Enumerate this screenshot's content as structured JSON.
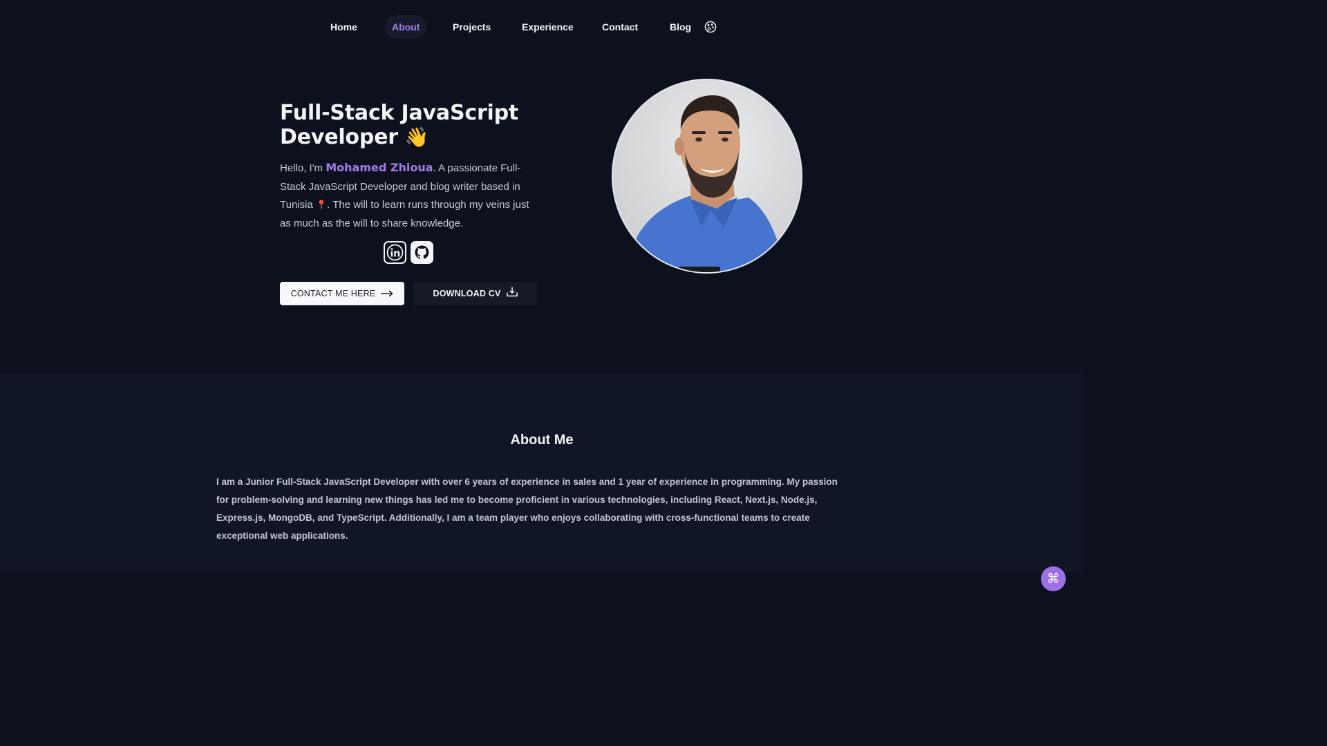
{
  "nav": {
    "items": [
      {
        "label": "Home"
      },
      {
        "label": "About",
        "active": true
      },
      {
        "label": "Projects"
      },
      {
        "label": "Experience"
      },
      {
        "label": "Contact"
      },
      {
        "label": "Blog"
      }
    ],
    "theme_icon": "palette-icon"
  },
  "hero": {
    "title": "Full-Stack JavaScript Developer",
    "wave_emoji": "👋",
    "intro_prefix": "Hello, I'm ",
    "name": "Mohamed Zhioua",
    "intro_mid": ". A passionate Full-Stack JavaScript Developer and blog writer based in Tunisia ",
    "pin": "📍",
    "intro_suffix": ". The will to learn runs through my veins just as much as the will to share knowledge.",
    "socials": [
      "linkedin-icon",
      "github-icon"
    ],
    "contact_button": "CONTACT ME HERE",
    "cv_button": "DOWNLOAD CV",
    "accent_color": "#a47ee8"
  },
  "about": {
    "title": "About Me",
    "text": "I am a Junior Full-Stack JavaScript Developer with over 6 years of experience in sales and 1 year of experience in programming. My passion for problem-solving and learning new things has led me to become proficient in various technologies, including React, Next.js, Node.js, Express.js, MongoDB, and TypeScript. Additionally, I am a team player who enjoys collaborating with cross-functional teams to create exceptional web applications."
  },
  "floating": {
    "command_icon": "command-icon",
    "symbol": "⌘"
  }
}
